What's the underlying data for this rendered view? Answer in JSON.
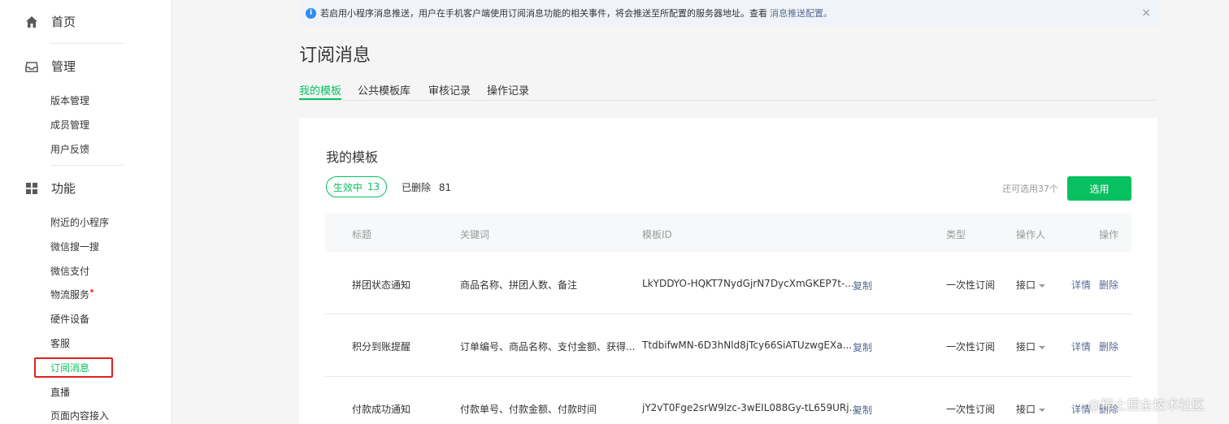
{
  "sidebar": {
    "home": {
      "label": "首页",
      "icon": "home-icon"
    },
    "manage": {
      "label": "管理",
      "icon": "inbox-icon"
    },
    "manage_items": [
      "版本管理",
      "成员管理",
      "用户反馈"
    ],
    "features": {
      "label": "功能",
      "icon": "grid-icon"
    },
    "feature_items": [
      "附近的小程序",
      "微信搜一搜",
      "微信支付",
      "物流服务",
      "硬件设备",
      "客服",
      "订阅消息",
      "直播",
      "页面内容接入"
    ]
  },
  "notice": {
    "text": "若启用小程序消息推送，用户在手机客户端使用订阅消息功能的相关事件，将会推送至所配置的服务器地址。查看",
    "link": "消息推送配置。",
    "close": "×"
  },
  "page": {
    "title": "订阅消息"
  },
  "tabs": [
    "我的模板",
    "公共模板库",
    "审核记录",
    "操作记录"
  ],
  "card": {
    "title": "我的模板",
    "active_label": "生效中",
    "active_count": "13",
    "deleted_label": "已删除",
    "deleted_count": "81",
    "remaining": "还可选用37个",
    "select_button": "选用"
  },
  "table": {
    "headers": [
      "标题",
      "关键词",
      "模板ID",
      "类型",
      "操作人",
      "操作"
    ],
    "rows": [
      {
        "title": "拼团状态通知",
        "keywords": "商品名称、拼团人数、备注",
        "template_id": "LkYDDYO-HQKT7NydGjrN7DycXmGKEP7t-...",
        "copy": "复制",
        "type": "一次性订阅",
        "operator": "接口",
        "detail": "详情",
        "delete": "删除"
      },
      {
        "title": "积分到账提醒",
        "keywords": "订单编号、商品名称、支付金额、获得...",
        "template_id": "TtdbifwMN-6D3hNld8jTcy66SiATUzwgEXa...",
        "copy": "复制",
        "type": "一次性订阅",
        "operator": "接口",
        "detail": "详情",
        "delete": "删除"
      },
      {
        "title": "付款成功通知",
        "keywords": "付款单号、付款金额、付款时间",
        "template_id": "jY2vT0Fge2srW9lzc-3wEIL088Gy-tL659URj...",
        "copy": "复制",
        "type": "一次性订阅",
        "operator": "接口",
        "detail": "详情",
        "delete": "删除"
      }
    ]
  },
  "watermark": "@稀土掘金技术社区",
  "colors": {
    "accent": "#07c160",
    "link": "#576b95",
    "highlight_box": "#e02020"
  }
}
